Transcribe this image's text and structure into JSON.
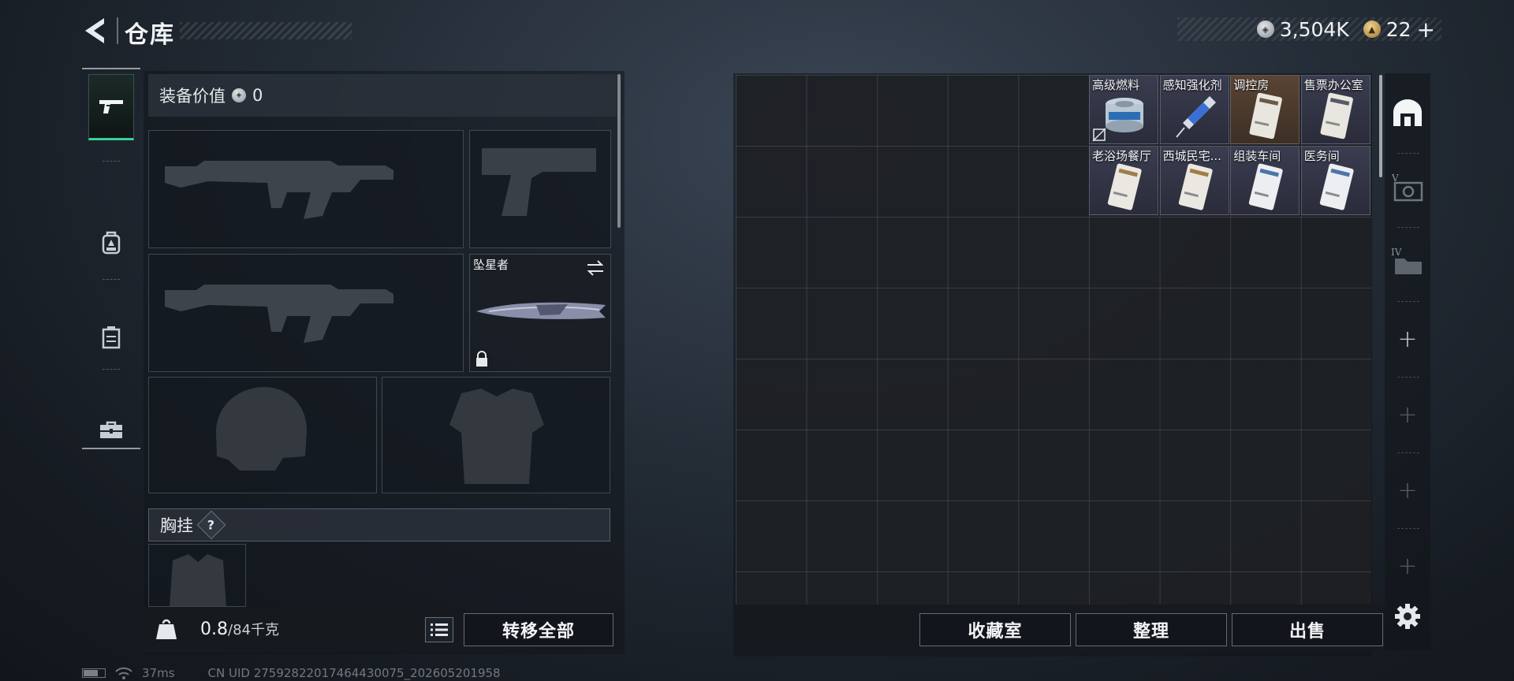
{
  "header": {
    "title": "仓库",
    "currency_silver": "3,504K",
    "currency_gold": "22"
  },
  "left_rail": {
    "items": [
      {
        "name": "weapons",
        "icon": "pistol-icon",
        "active": true
      },
      {
        "name": "backpack",
        "icon": "backpack-icon",
        "active": false
      },
      {
        "name": "container",
        "icon": "container-icon",
        "active": false
      },
      {
        "name": "toolbox",
        "icon": "toolbox-icon",
        "active": false
      }
    ]
  },
  "equipment": {
    "value_label": "装备价值",
    "value": "0",
    "melee_name": "坠星者",
    "chest_rig_label": "胸挂",
    "help_glyph": "?"
  },
  "footer_left": {
    "weight_current": "0.8",
    "weight_max": "/84千克",
    "kg_label": "KG",
    "transfer_all": "转移全部"
  },
  "stash": {
    "items": [
      {
        "name": "高级燃料",
        "art": "fuel-can-icon",
        "tone": "dark"
      },
      {
        "name": "感知强化剂",
        "art": "syringe-icon",
        "tone": "dark"
      },
      {
        "name": "调控房",
        "art": "keycard-icon",
        "tone": "brown"
      },
      {
        "name": "售票办公室",
        "art": "keycard-icon",
        "tone": "dark"
      },
      {
        "name": "老浴场餐厅",
        "art": "keycard-icon",
        "tone": "dark"
      },
      {
        "name": "西城民宅...",
        "art": "keycard-icon",
        "tone": "dark"
      },
      {
        "name": "组装车间",
        "art": "keycard-icon",
        "tone": "dark"
      },
      {
        "name": "医务间",
        "art": "keycard-icon",
        "tone": "dark"
      }
    ],
    "buttons": {
      "collection": "收藏室",
      "organize": "整理",
      "sell": "出售"
    }
  },
  "status_bar": {
    "ping": "37ms",
    "uid": "CN UID 275928220174644300​75_202605201958"
  },
  "colors": {
    "accent": "#35d39a",
    "panel": "#1a2028"
  }
}
